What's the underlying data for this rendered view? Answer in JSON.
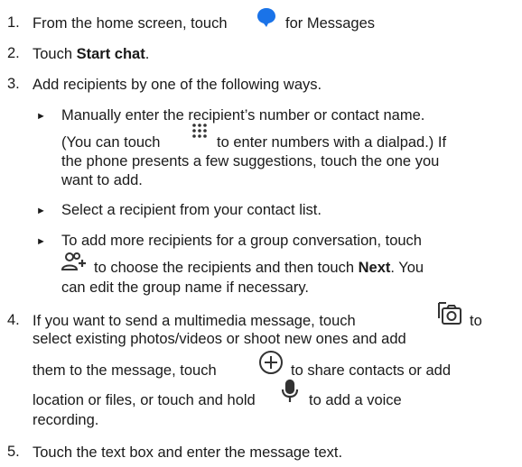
{
  "steps": [
    {
      "number": "1.",
      "before": "From the home screen, touch",
      "after": "for Messages",
      "icon": "messages-app-icon",
      "icon_color": "#1a73e8"
    },
    {
      "number": "2.",
      "before": "Touch ",
      "bold": "Start chat",
      "after": "."
    },
    {
      "number": "3.",
      "text": "Add recipients by one of the following ways."
    },
    {
      "number": "4.",
      "line1_before": "If you want to send a multimedia message, touch",
      "line1_after": "to",
      "line2": "select existing photos/videos or shoot new ones and add",
      "line3_before": "them to the message, touch",
      "line3_after": "to share contacts or add",
      "line4_before": "location or files, or touch and hold",
      "line4_after": "to add a voice",
      "line5": "recording.",
      "icons": [
        "gallery-camera-icon",
        "add-circle-icon",
        "microphone-icon"
      ]
    },
    {
      "number": "5.",
      "text": "Touch the text box and enter the message text."
    }
  ],
  "bullets": [
    {
      "line1": "Manually enter the recipient’s number or contact name.",
      "line2_before": "(You can touch",
      "line2_after": "to enter numbers with a dialpad.) If",
      "line3": "the phone presents a few suggestions, touch the one you",
      "line4": "want to add.",
      "icon": "dialpad-icon"
    },
    {
      "line1": "Select a recipient from your contact list."
    },
    {
      "line1": "To add more recipients for a group conversation, touch",
      "line2_after": "to choose the recipients and then touch ",
      "line2_bold": "Next",
      "line2_end": ". You",
      "line3": "can edit the group name if necessary.",
      "icon": "add-group-icon"
    }
  ],
  "bullet_symbol": "►"
}
